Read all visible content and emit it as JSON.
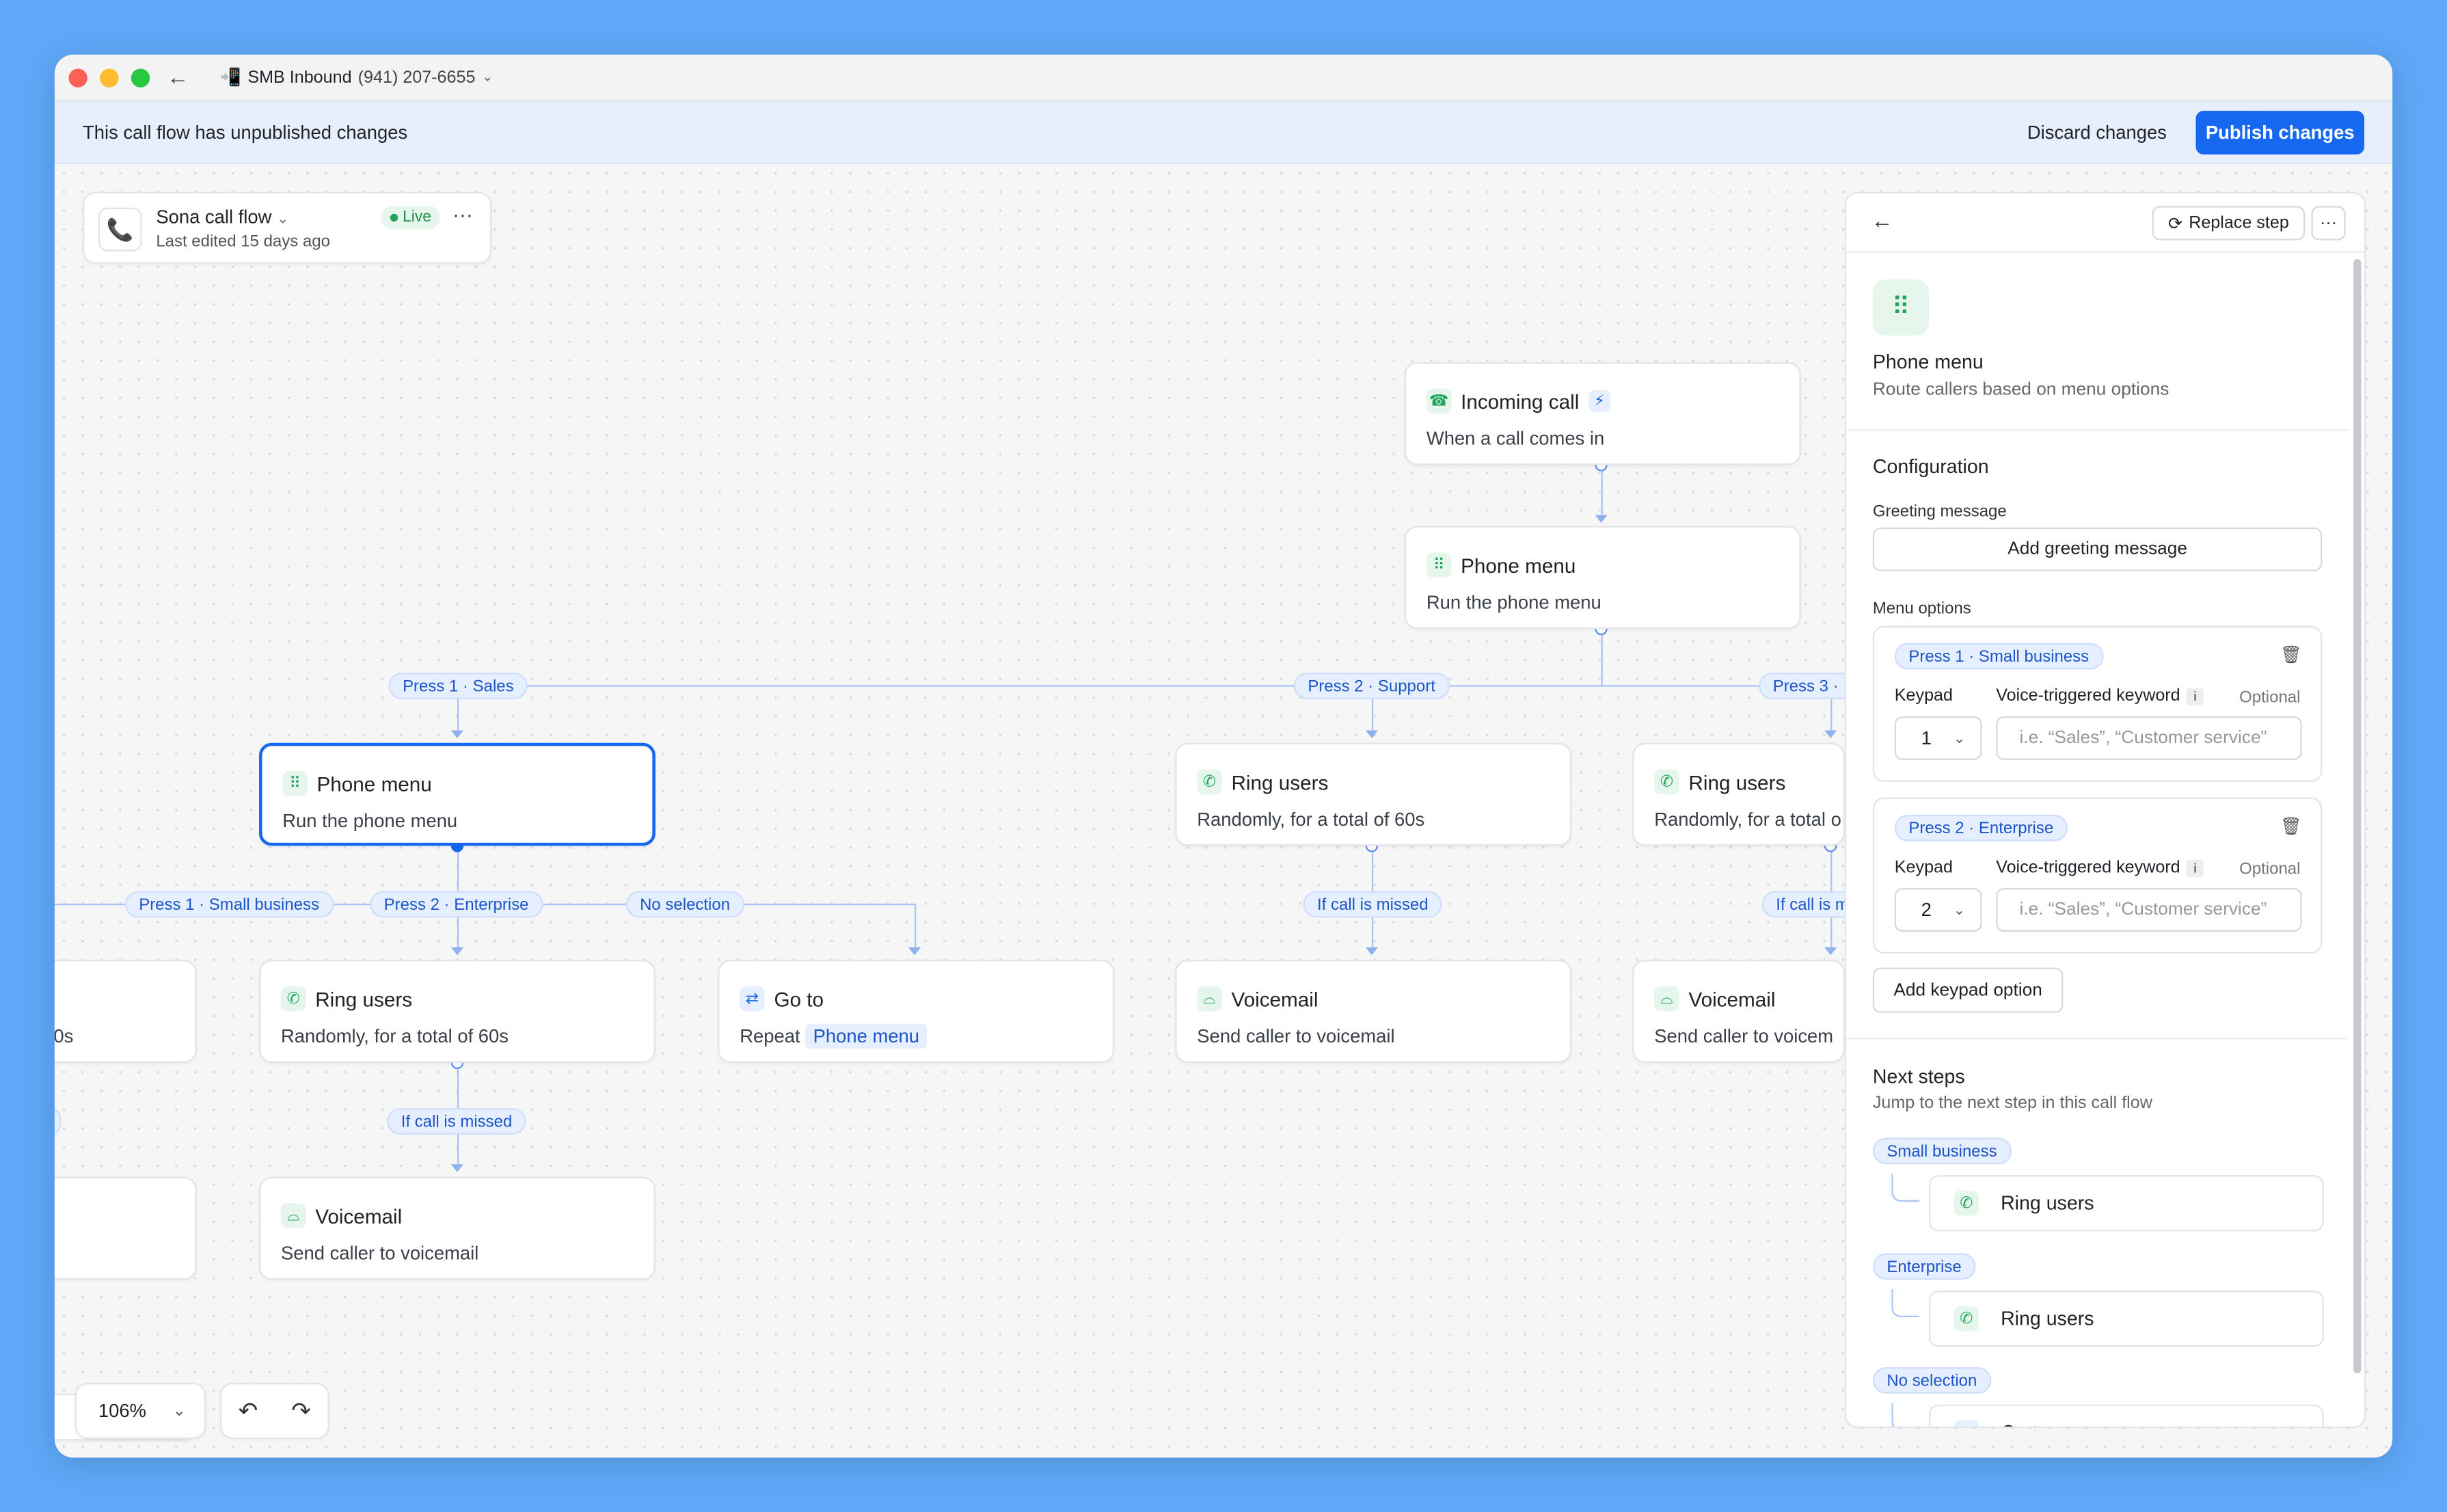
{
  "window": {
    "title": "SMB Inbound",
    "phone": "(941) 207-6655",
    "colors": {
      "accent": "#1668f0",
      "banner": "#e8effc",
      "success": "#1fa35a"
    }
  },
  "banner": {
    "message": "This call flow has unpublished changes",
    "discard_label": "Discard changes",
    "publish_label": "Publish changes"
  },
  "flow": {
    "name": "Sona call flow",
    "status": "Live",
    "last_edited": "Last edited 15 days ago"
  },
  "nodes": {
    "incoming": {
      "title": "Incoming call",
      "subtitle": "When a call comes in"
    },
    "menu_main": {
      "title": "Phone menu",
      "subtitle": "Run the phone menu"
    },
    "menu_selected": {
      "title": "Phone menu",
      "subtitle": "Run the phone menu"
    },
    "ring_support": {
      "title": "Ring users",
      "subtitle": "Randomly, for a total of 60s"
    },
    "ring_third": {
      "title": "Ring users",
      "subtitle": "Randomly, for a total o"
    },
    "ring_enterprise": {
      "title": "Ring users",
      "subtitle": "Randomly, for a total of 60s"
    },
    "goto": {
      "title": "Go to",
      "subtitle_prefix": "Repeat",
      "target": "Phone menu"
    },
    "vm_support": {
      "title": "Voicemail",
      "subtitle": "Send caller to voicemail"
    },
    "vm_third": {
      "title": "Voicemail",
      "subtitle": "Send caller to voicem"
    },
    "vm_enterprise": {
      "title": "Voicemail",
      "subtitle": "Send caller to voicemail"
    },
    "left_partial": {
      "subtitle": "0s"
    }
  },
  "edges": {
    "press1_sales": "Press 1 · Sales",
    "press2_support": "Press 2 · Support",
    "press3_partial": "Press 3 ·",
    "press1_small": "Press 1 · Small business",
    "press2_enterprise": "Press 2 · Enterprise",
    "no_selection": "No selection",
    "missed_support": "If call is missed",
    "missed_third": "If call is m",
    "missed_enterprise": "If call is missed"
  },
  "toolbar": {
    "zoom": "106%"
  },
  "panel": {
    "replace_label": "Replace step",
    "title": "Phone menu",
    "subtitle": "Route callers based on menu options",
    "configuration_heading": "Configuration",
    "greeting_label": "Greeting message",
    "greeting_button": "Add greeting message",
    "menu_options_label": "Menu options",
    "options": [
      {
        "tag": "Press 1 · Small business",
        "keypad_label": "Keypad",
        "keyword_label": "Voice-triggered keyword",
        "optional": "Optional",
        "key": "1",
        "placeholder": "i.e. “Sales”, “Customer service”"
      },
      {
        "tag": "Press 2 · Enterprise",
        "keypad_label": "Keypad",
        "keyword_label": "Voice-triggered keyword",
        "optional": "Optional",
        "key": "2",
        "placeholder": "i.e. “Sales”, “Customer service”"
      }
    ],
    "add_option_label": "Add keypad option",
    "next_heading": "Next steps",
    "next_sub": "Jump to the next step in this call flow",
    "next_steps": [
      {
        "tag": "Small business",
        "step": "Ring users"
      },
      {
        "tag": "Enterprise",
        "step": "Ring users"
      },
      {
        "tag": "No selection",
        "step": "Go to"
      }
    ]
  }
}
